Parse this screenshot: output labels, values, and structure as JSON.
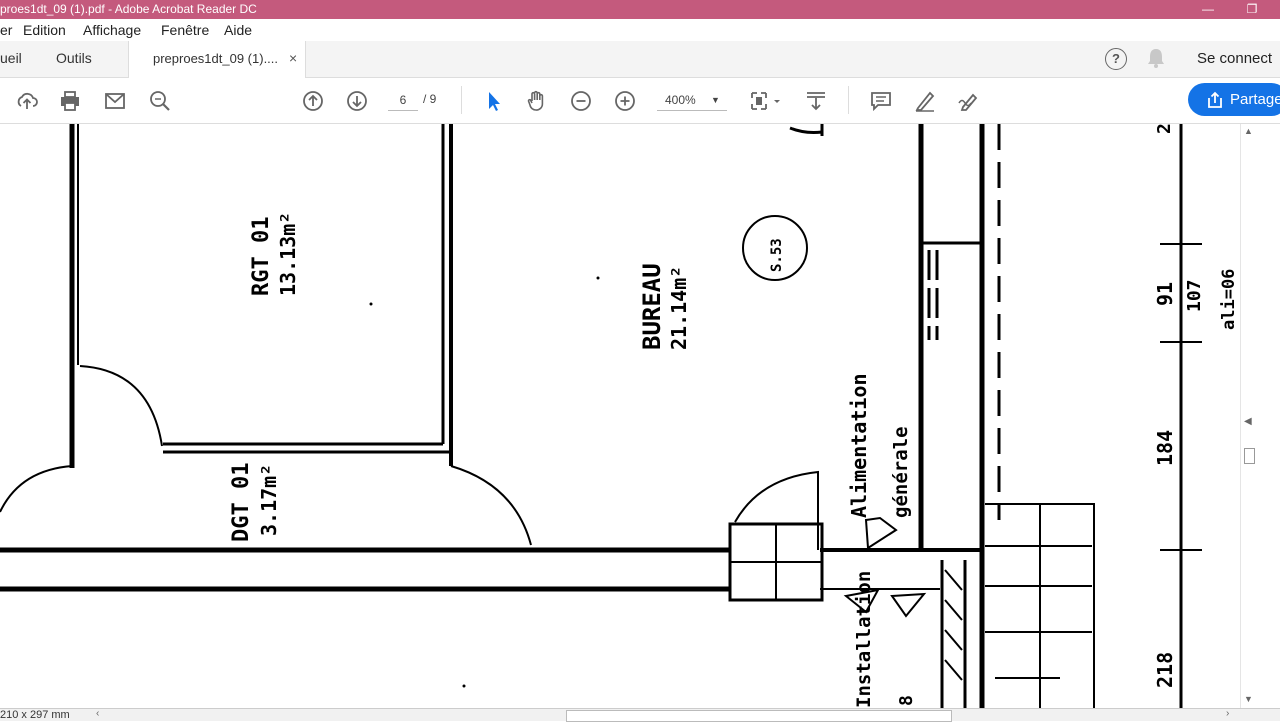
{
  "window": {
    "title": "proes1dt_09 (1).pdf - Adobe Acrobat Reader DC",
    "minimize": "—",
    "restore": "❐"
  },
  "menu": {
    "items": [
      "er",
      "Edition",
      "Affichage",
      "Fenêtre",
      "Aide"
    ]
  },
  "tabs": {
    "home": "ueil",
    "tools": "Outils",
    "document": "preproes1dt_09 (1)....",
    "close": "×"
  },
  "header": {
    "help": "?",
    "signin": "Se connect"
  },
  "toolbar": {
    "current_page": "6",
    "total_pages": "/ 9",
    "zoom": "400%",
    "share_label": "Partage",
    "accent_color": "#1473e6"
  },
  "plan": {
    "room1_name": "RGT 01",
    "room1_area": "13.13m²",
    "room2_name": "BUREAU",
    "room2_area": "21.14m²",
    "room3_name": "DGT 01",
    "room3_area": "3.17m²",
    "symbol_label": "S.53",
    "label_alim": "Alimentation",
    "label_gen": "générale",
    "label_inst": "Installation",
    "dim1": "91",
    "dim2": "107",
    "dim3": "ali=06",
    "dim4": "184",
    "dim5": "218",
    "dim6": "2",
    "dim7": "8"
  },
  "status": {
    "page_size": "210 x 297 mm"
  }
}
